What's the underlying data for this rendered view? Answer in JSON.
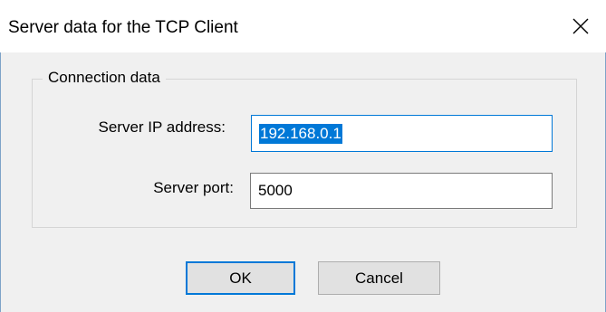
{
  "window": {
    "title": "Server data for the TCP Client",
    "close_icon": "close-icon"
  },
  "groupbox": {
    "title": "Connection data"
  },
  "fields": {
    "ip_label": "Server IP address:",
    "ip_value": "192.168.0.1",
    "port_label": "Server port:",
    "port_value": "5000"
  },
  "buttons": {
    "ok_label": "OK",
    "cancel_label": "Cancel"
  },
  "colors": {
    "accent": "#0078d7",
    "titlebar": "#ffffff",
    "dialog_bg": "#f0f0f0",
    "button_bg": "#e1e1e1"
  }
}
